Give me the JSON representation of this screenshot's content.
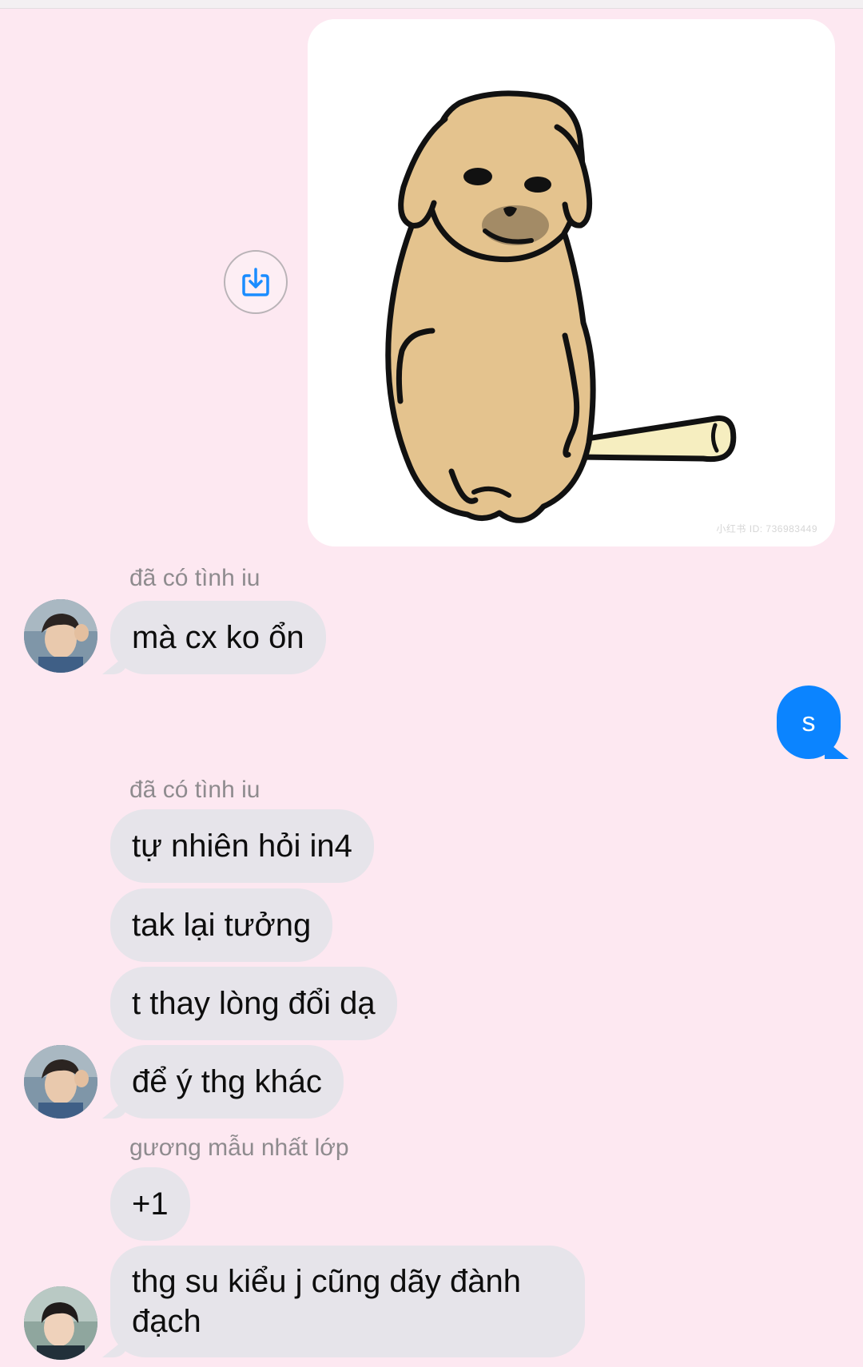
{
  "image_message": {
    "watermark": "小红书 ID: 736983449"
  },
  "incoming_messages": [
    {
      "sender": "đã có tình iu",
      "lines": [
        "mà cx ko ổn"
      ]
    },
    {
      "sender": "đã có tình iu",
      "lines": [
        "tự nhiên hỏi in4",
        "tak lại tưởng",
        "t thay lòng đổi dạ",
        "để ý thg khác"
      ]
    },
    {
      "sender": "gương mẫu nhất lớp",
      "lines": [
        "+1",
        "thg su kiểu j cũng dãy đành đạch"
      ]
    }
  ],
  "outgoing_message": "s",
  "icons": {
    "save": "download-to-device-icon",
    "avatar": "profile-avatar"
  },
  "colors": {
    "background": "#fde8f1",
    "incoming_bubble": "#e6e4ea",
    "outgoing_bubble": "#0b84ff",
    "save_icon": "#1a8cff"
  }
}
